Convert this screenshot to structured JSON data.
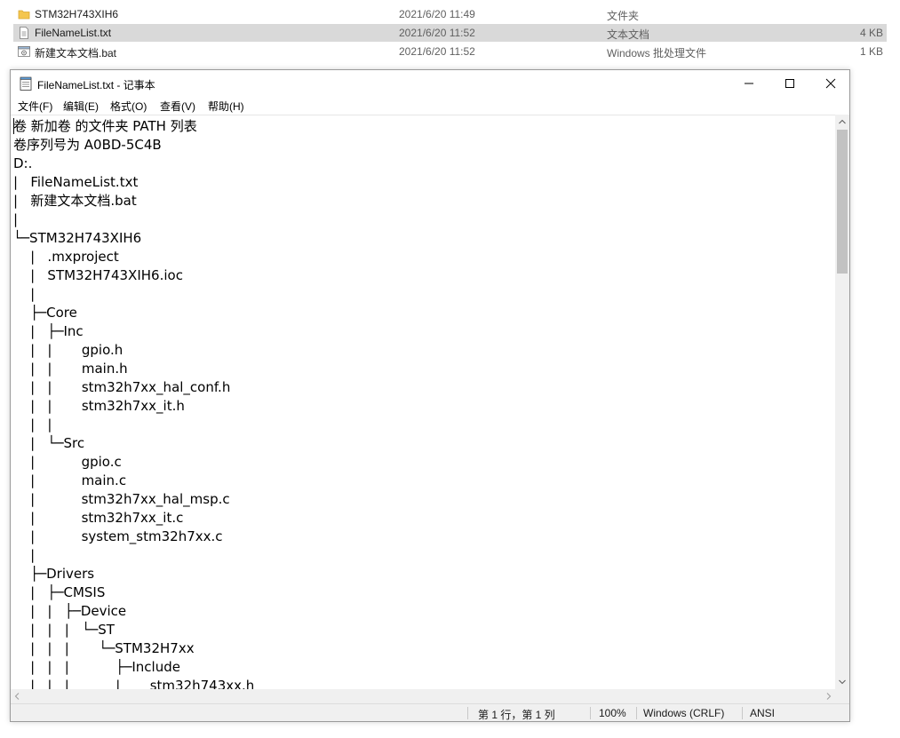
{
  "explorer": {
    "files": [
      {
        "name": "STM32H743XIH6",
        "date": "2021/6/20 11:49",
        "type": "文件夹",
        "size": "",
        "icon": "folder-icon",
        "selected": false
      },
      {
        "name": "FileNameList.txt",
        "date": "2021/6/20 11:52",
        "type": "文本文档",
        "size": "4 KB",
        "icon": "text-file-icon",
        "selected": true
      },
      {
        "name": "新建文本文档.bat",
        "date": "2021/6/20 11:52",
        "type": "Windows 批处理文件",
        "size": "1 KB",
        "icon": "batch-file-icon",
        "selected": false
      }
    ]
  },
  "window": {
    "title": "FileNameList.txt - 记事本",
    "icon": "notepad-icon",
    "controls": [
      "minimize-icon",
      "maximize-icon",
      "close-icon"
    ]
  },
  "menu": [
    {
      "label": "文件(F)"
    },
    {
      "label": "编辑(E)"
    },
    {
      "label": "格式(O)"
    },
    {
      "label": "查看(V)"
    },
    {
      "label": "帮助(H)"
    }
  ],
  "editor": {
    "lines": [
      "卷 新加卷 的文件夹 PATH 列表",
      "卷序列号为 A0BD-5C4B",
      "D:.",
      "|   FileNameList.txt",
      "|   新建文本文档.bat",
      "|",
      "└─STM32H743XIH6",
      "    |   .mxproject",
      "    |   STM32H743XIH6.ioc",
      "    |",
      "    ├─Core",
      "    |   ├─Inc",
      "    |   |       gpio.h",
      "    |   |       main.h",
      "    |   |       stm32h7xx_hal_conf.h",
      "    |   |       stm32h7xx_it.h",
      "    |   |",
      "    |   └─Src",
      "    |           gpio.c",
      "    |           main.c",
      "    |           stm32h7xx_hal_msp.c",
      "    |           stm32h7xx_it.c",
      "    |           system_stm32h7xx.c",
      "    |",
      "    ├─Drivers",
      "    |   ├─CMSIS",
      "    |   |   ├─Device",
      "    |   |   |   └─ST",
      "    |   |   |       └─STM32H7xx",
      "    |   |   |           ├─Include",
      "    |   |   |           |       stm32h743xx.h"
    ]
  },
  "statusbar": {
    "position": "第 1 行，第 1 列",
    "zoom": "100%",
    "line_ending": "Windows (CRLF)",
    "encoding": "ANSI"
  },
  "colors": {
    "selection": "#d9d9d9",
    "scrollbar_track": "#f0f0f0",
    "scrollbar_thumb": "#c2c2c2",
    "folder": "#f4c64f"
  }
}
